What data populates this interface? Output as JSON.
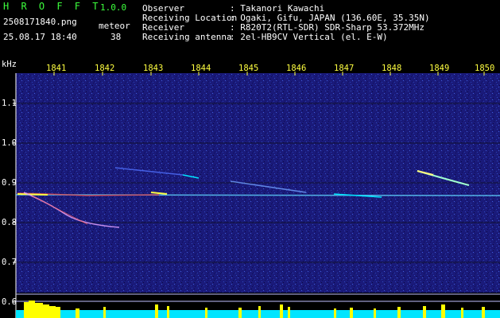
{
  "app": {
    "name": "H R O F F T",
    "version": "1.0.0",
    "filename": "2508171840.png",
    "datetime": "25.08.17 18:40",
    "mode_label": "meteor",
    "count": "38"
  },
  "info": {
    "rows": [
      {
        "label": "Observer",
        "value": ": Takanori Kawachi"
      },
      {
        "label": "Receiving Location",
        "value": ": Ogaki, Gifu, JAPAN (136.60E, 35.35N)"
      },
      {
        "label": "Receiver",
        "value": ": R820T2(RTL-SDR) SDR-Sharp 53.372MHz"
      },
      {
        "label": "Receiving antenna",
        "value": ": 2el-HB9CV Vertical (el. E-W)"
      }
    ]
  },
  "axis": {
    "unit": "kHz",
    "time_ticks": [
      "1841",
      "1842",
      "1843",
      "1844",
      "1845",
      "1846",
      "1847",
      "1848",
      "1849",
      "1850"
    ],
    "freq_ticks": [
      "1.1",
      "1.0",
      "0.9",
      "0.8",
      "0.7",
      "0.6"
    ]
  },
  "colors": {
    "background": "#000000",
    "header_green": "#3cff3c",
    "tick_yellow": "#ffff40",
    "spectrum_cyan": "#00e5ff",
    "spectrum_yellow": "#ffff00"
  }
}
